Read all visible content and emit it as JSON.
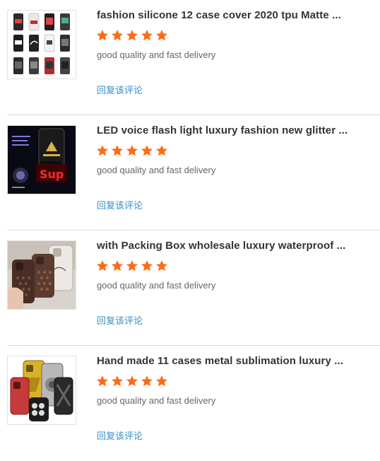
{
  "colors": {
    "star": "#ff6a13",
    "link": "#3a8fc4",
    "divider": "#d9d9d9"
  },
  "reviews": [
    {
      "product_title": "fashion silicone 12 case cover 2020 tpu Matte ...",
      "rating": 5,
      "comment": "good quality and fast delivery",
      "reply_label": "回复该评论",
      "image_icon": "phone-case-grid-image"
    },
    {
      "product_title": "LED voice flash light luxury fashion new glitter ...",
      "rating": 5,
      "comment": "good quality and fast delivery",
      "reply_label": "回复该评论",
      "image_icon": "led-phone-case-image"
    },
    {
      "product_title": "with Packing Box wholesale luxury waterproof ...",
      "rating": 5,
      "comment": "good quality and fast delivery",
      "reply_label": "回复该评论",
      "image_icon": "leather-phone-case-image"
    },
    {
      "product_title": "Hand made 11 cases metal sublimation luxury ...",
      "rating": 5,
      "comment": "good quality and fast delivery",
      "reply_label": "回复该评论",
      "image_icon": "metal-phone-case-image"
    }
  ]
}
